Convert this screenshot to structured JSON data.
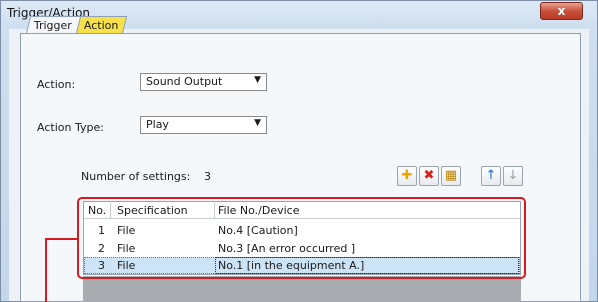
{
  "window": {
    "title": "Trigger/Action",
    "close_label": "x"
  },
  "tabs": [
    {
      "label": "Trigger",
      "active": false
    },
    {
      "label": "Action",
      "active": true
    }
  ],
  "form": {
    "action_label": "Action:",
    "action_value": "Sound Output",
    "action_type_label": "Action Type:",
    "action_type_value": "Play"
  },
  "settings": {
    "count_label": "Number of settings:",
    "count_value": "3"
  },
  "toolbar": {
    "icons": [
      "add-icon",
      "delete-icon",
      "copy-icon",
      "move-up-icon",
      "move-down-icon"
    ]
  },
  "table": {
    "headers": [
      "No.",
      "Specification",
      "File No./Device"
    ],
    "rows": [
      {
        "no": "1",
        "spec": "File",
        "device": "No.4 [Caution]"
      },
      {
        "no": "2",
        "spec": "File",
        "device": "No.3 [An error occurred ]"
      },
      {
        "no": "3",
        "spec": "File",
        "device": "No.1 [in the equipment A.]"
      }
    ],
    "selected_row": 3
  },
  "colors": {
    "active_tab": "#f7e04a",
    "selection": "#cde4f7",
    "annotation": "#d81b21",
    "close_button": "#c8513c"
  }
}
